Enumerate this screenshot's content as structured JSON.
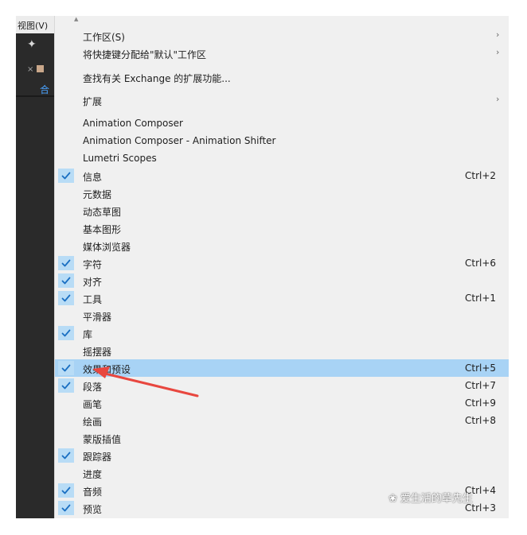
{
  "app": {
    "view_menu_label": "视图(V)",
    "left_tab_label": "合"
  },
  "menu": {
    "items": [
      {
        "label": "工作区(S)",
        "shortcut": "",
        "checked": false,
        "submenu": true
      },
      {
        "label": "将快捷键分配给\"默认\"工作区",
        "shortcut": "",
        "checked": false,
        "submenu": true
      },
      {
        "label": "查找有关 Exchange 的扩展功能...",
        "shortcut": "",
        "checked": false,
        "submenu": false
      },
      {
        "label": "扩展",
        "shortcut": "",
        "checked": false,
        "submenu": true
      },
      {
        "label": "Animation Composer",
        "shortcut": "",
        "checked": false,
        "submenu": false
      },
      {
        "label": "Animation Composer - Animation Shifter",
        "shortcut": "",
        "checked": false,
        "submenu": false
      },
      {
        "label": "Lumetri Scopes",
        "shortcut": "",
        "checked": false,
        "submenu": false
      },
      {
        "label": "信息",
        "shortcut": "Ctrl+2",
        "checked": true,
        "submenu": false
      },
      {
        "label": "元数据",
        "shortcut": "",
        "checked": false,
        "submenu": false
      },
      {
        "label": "动态草图",
        "shortcut": "",
        "checked": false,
        "submenu": false
      },
      {
        "label": "基本图形",
        "shortcut": "",
        "checked": false,
        "submenu": false
      },
      {
        "label": "媒体浏览器",
        "shortcut": "",
        "checked": false,
        "submenu": false
      },
      {
        "label": "字符",
        "shortcut": "Ctrl+6",
        "checked": true,
        "submenu": false
      },
      {
        "label": "对齐",
        "shortcut": "",
        "checked": true,
        "submenu": false
      },
      {
        "label": "工具",
        "shortcut": "Ctrl+1",
        "checked": true,
        "submenu": false
      },
      {
        "label": "平滑器",
        "shortcut": "",
        "checked": false,
        "submenu": false
      },
      {
        "label": "库",
        "shortcut": "",
        "checked": true,
        "submenu": false
      },
      {
        "label": "摇摆器",
        "shortcut": "",
        "checked": false,
        "submenu": false
      },
      {
        "label": "效果和预设",
        "shortcut": "Ctrl+5",
        "checked": true,
        "submenu": false,
        "highlighted": true
      },
      {
        "label": "段落",
        "shortcut": "Ctrl+7",
        "checked": true,
        "submenu": false
      },
      {
        "label": "画笔",
        "shortcut": "Ctrl+9",
        "checked": false,
        "submenu": false
      },
      {
        "label": "绘画",
        "shortcut": "Ctrl+8",
        "checked": false,
        "submenu": false
      },
      {
        "label": "蒙版插值",
        "shortcut": "",
        "checked": false,
        "submenu": false
      },
      {
        "label": "跟踪器",
        "shortcut": "",
        "checked": true,
        "submenu": false
      },
      {
        "label": "进度",
        "shortcut": "",
        "checked": false,
        "submenu": false
      },
      {
        "label": "音频",
        "shortcut": "Ctrl+4",
        "checked": true,
        "submenu": false
      },
      {
        "label": "预览",
        "shortcut": "Ctrl+3",
        "checked": true,
        "submenu": false
      }
    ]
  },
  "watermark": {
    "text": "爱生活的草先生"
  },
  "colors": {
    "highlight": "#a8d3f5",
    "check_bg": "#b8dcf6",
    "check_mark": "#1a6fc2",
    "annotation_arrow": "#e8473f",
    "menu_bg": "#f0f0f0"
  },
  "icons": {
    "check": "checkmark-icon",
    "submenu": "chevron-right-icon",
    "scroll_up": "scroll-up-arrow-icon"
  }
}
